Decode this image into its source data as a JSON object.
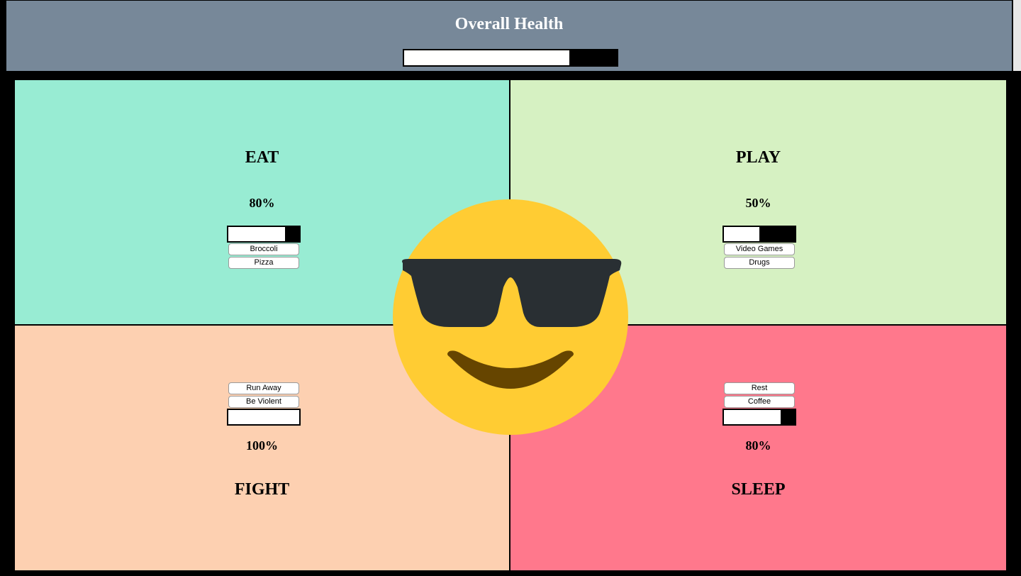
{
  "header": {
    "title": "Overall Health",
    "health_level": 0.775,
    "background": "#778899"
  },
  "quadrants": {
    "eat": {
      "label": "EAT",
      "percent": "80%",
      "level": 0.8,
      "color": "#98ecd3",
      "buttons": [
        "Broccoli",
        "Pizza"
      ]
    },
    "play": {
      "label": "PLAY",
      "percent": "50%",
      "level": 0.5,
      "color": "#d6f1c2",
      "buttons": [
        "Video Games",
        "Drugs"
      ]
    },
    "fight": {
      "label": "FIGHT",
      "percent": "100%",
      "level": 1.0,
      "color": "#fdd0b1",
      "buttons": [
        "Run Away",
        "Be Violent"
      ]
    },
    "sleep": {
      "label": "SLEEP",
      "percent": "80%",
      "level": 0.8,
      "color": "#ff788c",
      "buttons": [
        "Rest",
        "Coffee"
      ]
    }
  },
  "center": {
    "icon": "smiling-face-with-sunglasses-icon",
    "face_color": "#ffcc33",
    "glasses_color": "#292f33",
    "mouth_color": "#664500"
  }
}
